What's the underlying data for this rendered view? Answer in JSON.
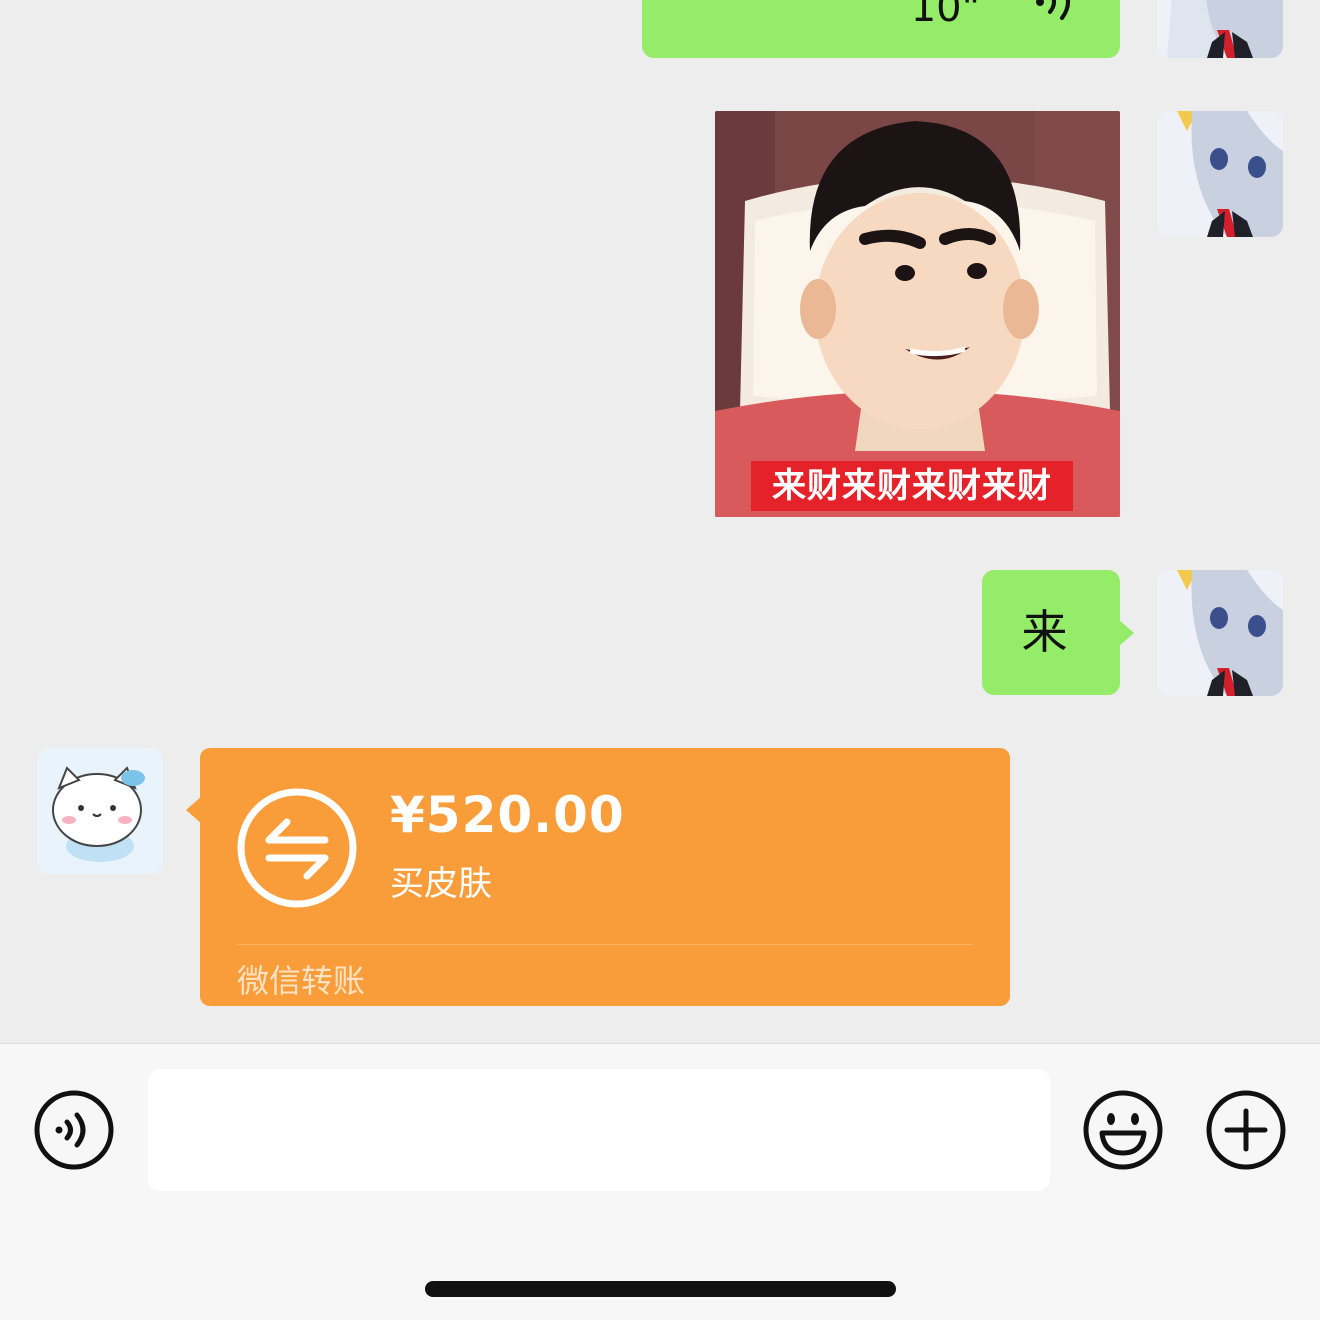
{
  "messages": {
    "voice": {
      "duration": "10\""
    },
    "sticker": {
      "caption": "来财来财来财来财"
    },
    "text": {
      "content": "来"
    },
    "transfer": {
      "amount": "¥520.00",
      "note": "买皮肤",
      "type_label": "微信转账"
    }
  },
  "input_bar": {
    "message_value": "",
    "voice_icon": "voice-icon",
    "emoji_icon": "emoji-icon",
    "plus_icon": "plus-icon"
  },
  "colors": {
    "chat_background": "#ededed",
    "sent_bubble": "#95ec69",
    "transfer_card": "#f99d3a",
    "sticker_caption": "#e5212a"
  }
}
